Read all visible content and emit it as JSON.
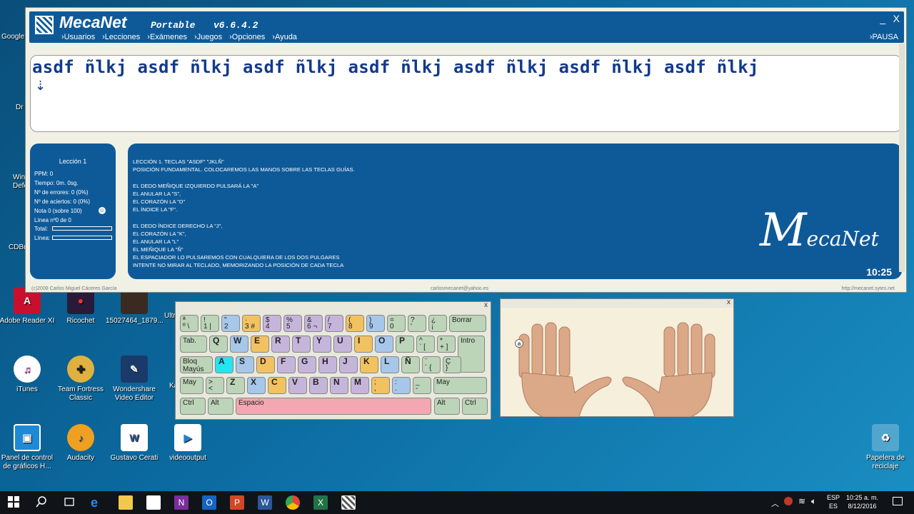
{
  "window": {
    "title": "MecaNet",
    "subtitle": "Portable",
    "version": "v6.6.4.2",
    "menu": [
      "Usuarios",
      "Lecciones",
      "Exámenes",
      "Juegos",
      "Opciones",
      "Ayuda"
    ],
    "pause_label": "PAUSA",
    "minimize": "_",
    "close": "X"
  },
  "practice": {
    "text": "asdf ñlkj asdf ñlkj asdf ñlkj asdf ñlkj asdf ñlkj asdf ñlkj asdf ñlkj"
  },
  "stats": {
    "title": "Lección 1",
    "ppm": "PPM: 0",
    "tiempo": "Tiempo: 0m. 0sg.",
    "errores": "Nº de errores: 0 (0%)",
    "aciertos": "Nº de aciertos: 0 (0%)",
    "nota": "Nota 0 (sobre 100)",
    "linea_num": "Línea nº0 de 0",
    "total_label": "Total:",
    "linea_label": "Línea:"
  },
  "lesson": {
    "lines": [
      "LECCIÓN 1. TECLAS \"ASDF\" \"JKLÑ\"",
      "POSICIÓN FUNDAMENTAL. COLOCAREMOS LAS MANOS SOBRE LAS TECLAS GUÍAS.",
      "",
      "EL DEDO MEÑIQUE IZQUIERDO PULSARÁ LA \"A\"",
      "EL ANULAR LA \"S\",",
      "EL CORAZÓN LA \"D\"",
      "EL ÍNDICE LA \"F\".",
      "",
      "EL DEDO ÍNDICE DERECHO LA \"J\",",
      "EL CORAZÓN LA \"K\",",
      "EL ANULAR LA \"L\"",
      "EL MEÑIQUE LA \"Ñ\"",
      "EL ESPACIADOR LO PULSAREMOS CON CUALQUIERA DE LOS DOS PULGARES",
      "INTENTE NO MIRAR AL TECLADO, MEMORIZANDO LA POSICIÓN DE CADA TECLA"
    ],
    "brand_m": "M",
    "brand_rest": "ecaNet",
    "clock": "10:25"
  },
  "footer": {
    "left": "(c)2008 Carlos Miguel Cáceres García",
    "mid": "carlosmecanet@yahoo.es",
    "right": "http://mecanet.sytes.net"
  },
  "keyboard": {
    "close": "x",
    "row1": [
      {
        "hi": "ª",
        "lo": "º \\",
        "c": "gray"
      },
      {
        "hi": "!",
        "lo": "1 |",
        "c": "gray"
      },
      {
        "hi": "\"",
        "lo": "2",
        "c": "blue"
      },
      {
        "hi": "·",
        "lo": "3 #",
        "c": "yel"
      },
      {
        "hi": "$",
        "lo": "4",
        "c": "purp"
      },
      {
        "hi": "%",
        "lo": "5",
        "c": "purp"
      },
      {
        "hi": "&",
        "lo": "6 ¬",
        "c": "purp"
      },
      {
        "hi": "/",
        "lo": "7",
        "c": "purp"
      },
      {
        "hi": "(",
        "lo": "8",
        "c": "yel"
      },
      {
        "hi": ")",
        "lo": "9",
        "c": "blue"
      },
      {
        "hi": "=",
        "lo": "0",
        "c": "gray"
      },
      {
        "hi": "?",
        "lo": "'",
        "c": "gray"
      },
      {
        "hi": "¿",
        "lo": "¡",
        "c": "gray"
      }
    ],
    "borrar": "Borrar",
    "tab": "Tab.",
    "row2": [
      {
        "k": "Q",
        "c": "gray"
      },
      {
        "k": "W",
        "c": "blue"
      },
      {
        "k": "E",
        "c": "yel"
      },
      {
        "k": "R",
        "c": "purp"
      },
      {
        "k": "T",
        "c": "purp"
      },
      {
        "k": "Y",
        "c": "purp"
      },
      {
        "k": "U",
        "c": "purp"
      },
      {
        "k": "I",
        "c": "yel"
      },
      {
        "k": "O",
        "c": "blue"
      },
      {
        "k": "P",
        "c": "gray"
      }
    ],
    "row2_extra": [
      {
        "hi": "^",
        "lo": "` [",
        "c": "gray"
      },
      {
        "hi": "*",
        "lo": "+ ]",
        "c": "gray"
      }
    ],
    "intro": "Intro",
    "bloq1": "Bloq",
    "bloq2": "Mayús",
    "row3": [
      {
        "k": "A",
        "c": "cyan"
      },
      {
        "k": "S",
        "c": "blue"
      },
      {
        "k": "D",
        "c": "yel"
      },
      {
        "k": "F",
        "c": "purp"
      },
      {
        "k": "G",
        "c": "purp"
      },
      {
        "k": "H",
        "c": "purp"
      },
      {
        "k": "J",
        "c": "purp"
      },
      {
        "k": "K",
        "c": "yel"
      },
      {
        "k": "L",
        "c": "blue"
      },
      {
        "k": "Ñ",
        "c": "gray"
      }
    ],
    "row3_extra": [
      {
        "hi": "¨",
        "lo": "´ {",
        "c": "gray"
      },
      {
        "hi": "Ç",
        "lo": "}",
        "c": "gray"
      }
    ],
    "may_left": "May",
    "row4": [
      {
        "hi": ">",
        "lo": "<",
        "c": "gray"
      },
      {
        "k": "Z",
        "c": "gray"
      },
      {
        "k": "X",
        "c": "blue"
      },
      {
        "k": "C",
        "c": "yel"
      },
      {
        "k": "V",
        "c": "purp"
      },
      {
        "k": "B",
        "c": "purp"
      },
      {
        "k": "N",
        "c": "purp"
      },
      {
        "k": "M",
        "c": "purp"
      },
      {
        "hi": ";",
        "lo": ",",
        "c": "yel"
      },
      {
        "hi": ":",
        "lo": ".",
        "c": "blue"
      },
      {
        "hi": "_",
        "lo": "-",
        "c": "gray"
      }
    ],
    "may_right": "May",
    "ctrl": "Ctrl",
    "alt": "Alt",
    "espacio": "Espacio",
    "alt_gr": "Alt",
    "ctrl_r": "Ctrl"
  },
  "hands": {
    "close": "x",
    "finger_label": "a"
  },
  "desktop_icons": [
    "Adobe Reader XI",
    "Ricochet",
    "15027464_1879...",
    "iTunes",
    "Team Fortress Classic",
    "Wondershare Video Editor",
    "Panel de control de gráficos H...",
    "Audacity",
    "Gustavo Cerati",
    "videooutput",
    "Papelera de reciclaje"
  ],
  "desktop_partial": [
    "Google",
    "Dr",
    "Win",
    "Defe",
    "CDBu",
    "Ultr",
    "Ka"
  ],
  "taskbar": {
    "lang1": "ESP",
    "lang2": "ES",
    "time": "10:25 a. m.",
    "date": "8/12/2016"
  }
}
